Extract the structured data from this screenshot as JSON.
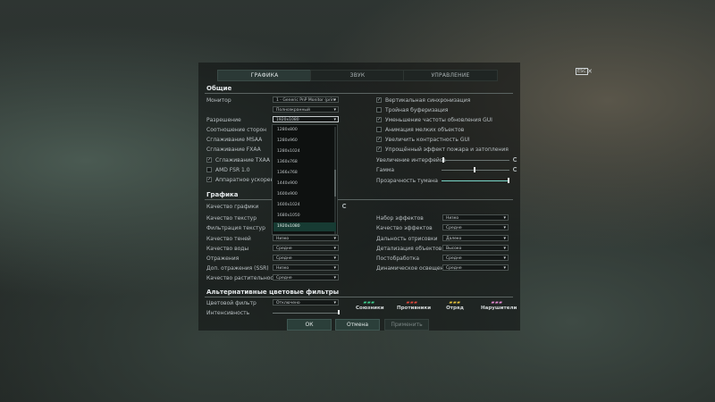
{
  "tabs": [
    {
      "label": "ГРАФИКА",
      "active": true
    },
    {
      "label": "ЗВУК",
      "active": false
    },
    {
      "label": "УПРАВЛЕНИЕ",
      "active": false
    }
  ],
  "top_right": {
    "key_label": "ESC",
    "close_symbol": "✕"
  },
  "general": {
    "title": "Общие",
    "monitor": {
      "label": "Монитор",
      "value": "1 - Generic PnP Monitor (prim"
    },
    "mode_value": "Полноэкранный",
    "resolution": {
      "label": "Разрешение",
      "value": "1920x1080"
    },
    "aspect_label": "Соотношение сторон",
    "msaa_label": "Сглаживание MSAA",
    "fxaa_label": "Сглаживание FXAA",
    "txaa": {
      "label": "Сглаживание TXAA",
      "checked": true
    },
    "fsr": {
      "label": "AMD FSR 1.0",
      "checked": false
    },
    "hwaccel": {
      "label": "Аппаратное ускорение игр",
      "checked": true
    },
    "resolution_options": [
      "1280x800",
      "1280x960",
      "1280x1024",
      "1360x768",
      "1366x768",
      "1440x900",
      "1600x900",
      "1600x1024",
      "1680x1050",
      "1920x1080"
    ],
    "selected_resolution": "1920x1080",
    "right_checks": [
      {
        "label": "Вертикальная синхронизация",
        "checked": true
      },
      {
        "label": "Тройная буферизация",
        "checked": false
      },
      {
        "label": "Уменьшение частоты обновления GUI",
        "checked": true
      },
      {
        "label": "Анимация мелких объектов",
        "checked": false
      },
      {
        "label": "Увеличить контрастность GUI",
        "checked": true
      },
      {
        "label": "Упрощённый эффект пожара и затопления",
        "checked": true
      }
    ],
    "sliders": [
      {
        "label": "Увеличение интерфейса",
        "value": 0.02
      },
      {
        "label": "Гамма",
        "value": 0.48
      },
      {
        "label": "Прозрачность тумана",
        "value": 1.0
      }
    ]
  },
  "graphics": {
    "title": "Графика",
    "quality_label": "Качество графики",
    "left": [
      {
        "label": "Качество текстур",
        "value": ""
      },
      {
        "label": "Фильтрация текстур",
        "value": ""
      },
      {
        "label": "Качество теней",
        "value": "Низко"
      },
      {
        "label": "Качество воды",
        "value": "Средне"
      },
      {
        "label": "Отражения",
        "value": "Средне"
      },
      {
        "label": "Доп. отражения (SSR)",
        "value": "Низко"
      },
      {
        "label": "Качество растительности",
        "value": "Средне"
      }
    ],
    "right": [
      {
        "label": "Набор эффектов",
        "value": "Низко"
      },
      {
        "label": "Качество эффектов",
        "value": "Средне"
      },
      {
        "label": "Дальность отрисовки",
        "value": "Далеко"
      },
      {
        "label": "Детализация объектов",
        "value": "Высоко"
      },
      {
        "label": "Постобработка",
        "value": "Средне"
      },
      {
        "label": "Динамическое освещение",
        "value": "Средне"
      }
    ]
  },
  "filters": {
    "title": "Альтернативные цветовые фильтры",
    "color_filter": {
      "label": "Цветовой фильтр",
      "value": "Отключено"
    },
    "intensity_label": "Интенсивность",
    "intensity_value": 1.0,
    "groups": [
      {
        "name": "Союзники",
        "color": "#3fd18f"
      },
      {
        "name": "Противники",
        "color": "#e0473c"
      },
      {
        "name": "Отряд",
        "color": "#e6c23a"
      },
      {
        "name": "Нарушители",
        "color": "#e58ad3"
      }
    ],
    "icon_glyph": "▰▰▰"
  },
  "buttons": {
    "ok": "ОК",
    "cancel": "Отмена",
    "apply": "Применить"
  }
}
